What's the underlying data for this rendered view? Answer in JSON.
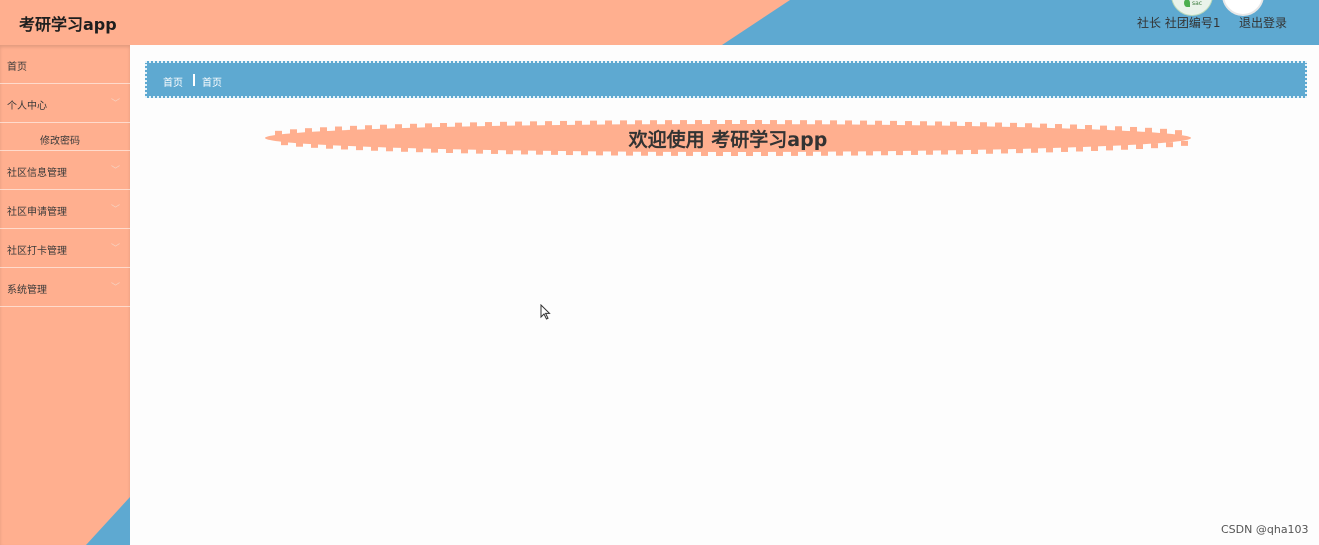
{
  "header": {
    "title": "考研学习app",
    "user_label": "社长 社团编号1",
    "logout_label": "退出登录",
    "avatar_caption": "sac"
  },
  "sidebar": {
    "items": [
      {
        "label": "首页",
        "has_children": false
      },
      {
        "label": "个人中心",
        "has_children": true,
        "children": [
          {
            "label": "修改密码"
          }
        ]
      },
      {
        "label": "社区信息管理",
        "has_children": true
      },
      {
        "label": "社区申请管理",
        "has_children": true
      },
      {
        "label": "社区打卡管理",
        "has_children": true
      },
      {
        "label": "系统管理",
        "has_children": true
      }
    ]
  },
  "breadcrumb": {
    "items": [
      "首页",
      "首页"
    ]
  },
  "welcome": {
    "text": "欢迎使用 考研学习app"
  },
  "watermark": "CSDN @qha103",
  "colors": {
    "accent_blue": "#5ea9d1",
    "accent_orange": "#ffaf8f"
  }
}
